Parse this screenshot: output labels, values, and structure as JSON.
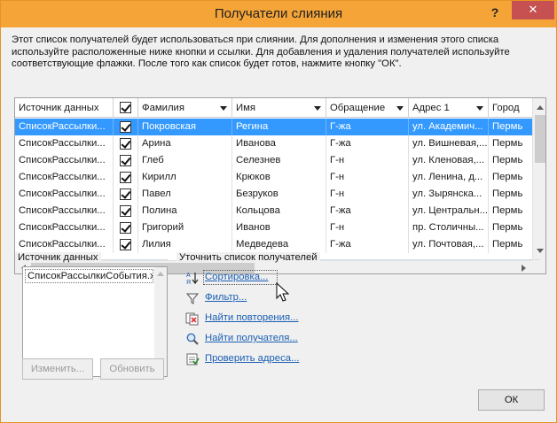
{
  "window": {
    "title": "Получатели слияния",
    "help_label": "?",
    "close_label": "✕"
  },
  "description": "Этот список получателей будет использоваться при слиянии. Для дополнения и изменения этого списка используйте расположенные ниже кнопки и ссылки. Для добавления и удаления получателей используйте соответствующие флажки. После того как список будет готов, нажмите кнопку \"ОК\".",
  "grid": {
    "columns": [
      {
        "key": "source",
        "label": "Источник данных",
        "dropdown": false
      },
      {
        "key": "check",
        "label": "",
        "dropdown": false,
        "checkbox": true
      },
      {
        "key": "last",
        "label": "Фамилия",
        "dropdown": true
      },
      {
        "key": "first",
        "label": "Имя",
        "dropdown": true
      },
      {
        "key": "title",
        "label": "Обращение",
        "dropdown": true
      },
      {
        "key": "address",
        "label": "Адрес 1",
        "dropdown": true
      },
      {
        "key": "city",
        "label": "Город",
        "dropdown": false
      }
    ],
    "rows": [
      {
        "source": "СписокРассылки...",
        "last": "Покровская",
        "first": "Регина",
        "title": "Г-жа",
        "address": "ул. Академич...",
        "city": "Пермь",
        "selected": true
      },
      {
        "source": "СписокРассылки...",
        "last": "Арина",
        "first": "Иванова",
        "title": "Г-жа",
        "address": "ул. Вишневая,...",
        "city": "Пермь"
      },
      {
        "source": "СписокРассылки...",
        "last": "Глеб",
        "first": "Селезнев",
        "title": "Г-н",
        "address": "ул. Кленовая,...",
        "city": "Пермь"
      },
      {
        "source": "СписокРассылки...",
        "last": "Кирилл",
        "first": "Крюков",
        "title": "Г-н",
        "address": "ул. Ленина, д...",
        "city": "Пермь"
      },
      {
        "source": "СписокРассылки...",
        "last": "Павел",
        "first": "Безруков",
        "title": "Г-н",
        "address": "ул. Зырянска...",
        "city": "Пермь"
      },
      {
        "source": "СписокРассылки...",
        "last": "Полина",
        "first": "Кольцова",
        "title": "Г-жа",
        "address": "ул. Центральн...",
        "city": "Пермь"
      },
      {
        "source": "СписокРассылки...",
        "last": "Григорий",
        "first": "Иванов",
        "title": "Г-н",
        "address": "пр. Столичны...",
        "city": "Пермь"
      },
      {
        "source": "СписокРассылки...",
        "last": "Лилия",
        "first": "Медведева",
        "title": "Г-жа",
        "address": "ул. Почтовая,...",
        "city": "Пермь"
      }
    ]
  },
  "data_source_group": {
    "label": "Источник данных",
    "items": [
      "СписокРассылкиСобытия.xlsx"
    ],
    "edit_label": "Изменить...",
    "refresh_label": "Обновить"
  },
  "refine_group": {
    "label": "Уточнить список получателей",
    "links": [
      {
        "label": "Сортировка...",
        "icon": "sort-icon"
      },
      {
        "label": "Фильтр...",
        "icon": "filter-icon"
      },
      {
        "label": "Найти повторения...",
        "icon": "find-duplicates-icon"
      },
      {
        "label": "Найти получателя...",
        "icon": "find-recipient-icon"
      },
      {
        "label": "Проверить адреса...",
        "icon": "validate-addresses-icon"
      }
    ]
  },
  "ok_label": "ОК",
  "colors": {
    "titlebar": "#f5a538",
    "close": "#c75050",
    "selection": "#3399ff",
    "link": "#1a5fb4"
  }
}
